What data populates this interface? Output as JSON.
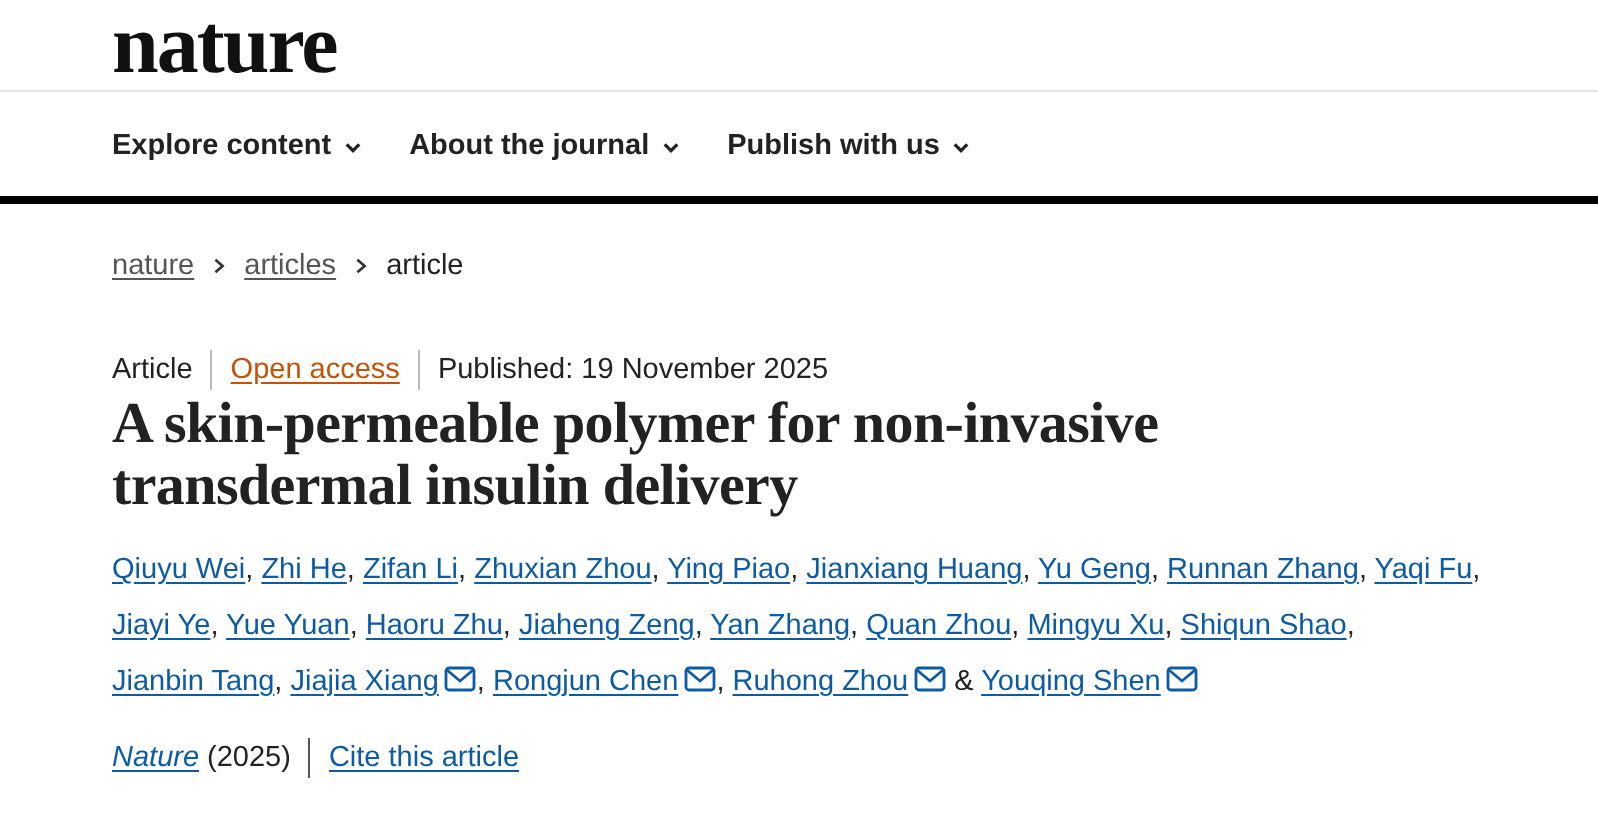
{
  "site": {
    "logo": "nature"
  },
  "nav": [
    {
      "label": "Explore content"
    },
    {
      "label": "About the journal"
    },
    {
      "label": "Publish with us"
    }
  ],
  "breadcrumb": [
    {
      "label": "nature",
      "link": true
    },
    {
      "label": "articles",
      "link": true
    },
    {
      "label": "article",
      "link": false
    }
  ],
  "meta": {
    "type": "Article",
    "access": "Open access",
    "published": "Published: 19 November 2025"
  },
  "title": "A skin-permeable polymer for non-invasive transdermal insulin delivery",
  "authors": [
    {
      "name": "Qiuyu Wei",
      "email": false,
      "sep": ","
    },
    {
      "name": "Zhi He",
      "email": false,
      "sep": ","
    },
    {
      "name": "Zifan Li",
      "email": false,
      "sep": ","
    },
    {
      "name": "Zhuxian Zhou",
      "email": false,
      "sep": ","
    },
    {
      "name": "Ying Piao",
      "email": false,
      "sep": ","
    },
    {
      "name": "Jianxiang Huang",
      "email": false,
      "sep": ","
    },
    {
      "name": "Yu Geng",
      "email": false,
      "sep": ","
    },
    {
      "name": "Runnan Zhang",
      "email": false,
      "sep": ","
    },
    {
      "name": "Yaqi Fu",
      "email": false,
      "sep": ","
    },
    {
      "name": "Jiayi Ye",
      "email": false,
      "sep": ","
    },
    {
      "name": "Yue Yuan",
      "email": false,
      "sep": ","
    },
    {
      "name": "Haoru Zhu",
      "email": false,
      "sep": ","
    },
    {
      "name": "Jiaheng Zeng",
      "email": false,
      "sep": ","
    },
    {
      "name": "Yan Zhang",
      "email": false,
      "sep": ","
    },
    {
      "name": "Quan Zhou",
      "email": false,
      "sep": ","
    },
    {
      "name": "Mingyu Xu",
      "email": false,
      "sep": ","
    },
    {
      "name": "Shiqun Shao",
      "email": false,
      "sep": ","
    },
    {
      "name": "Jianbin Tang",
      "email": false,
      "sep": ","
    },
    {
      "name": "Jiajia Xiang",
      "email": true,
      "sep": ","
    },
    {
      "name": "Rongjun Chen",
      "email": true,
      "sep": ","
    },
    {
      "name": "Ruhong Zhou",
      "email": true,
      "sep": "&"
    },
    {
      "name": "Youqing Shen",
      "email": true
    }
  ],
  "citation": {
    "journal": "Nature",
    "year": "(2025)",
    "cite": "Cite this article"
  }
}
